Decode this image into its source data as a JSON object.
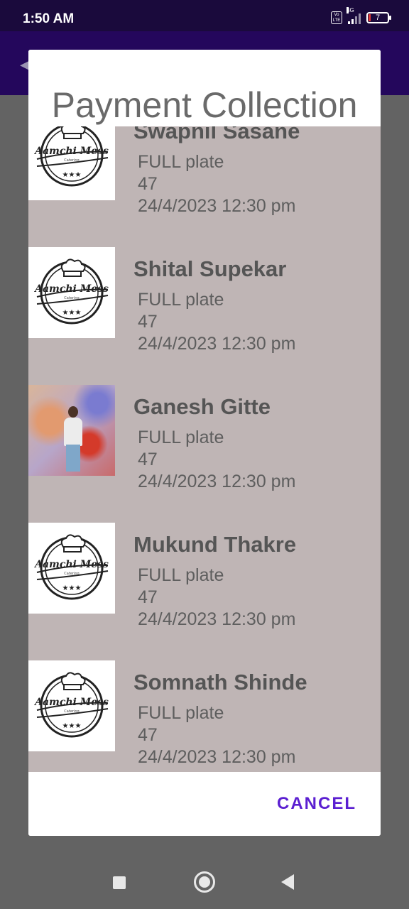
{
  "status_bar": {
    "time": "1:50 AM",
    "network": "4G",
    "volte": "Vo LTE",
    "battery": "7"
  },
  "dialog": {
    "title": "Payment Collection",
    "cancel_label": "CANCEL",
    "items": [
      {
        "name": "Swapnil Sasane",
        "plate": "FULL plate",
        "amount": "47",
        "datetime": "24/4/2023 12:30 pm",
        "image": "mess-logo"
      },
      {
        "name": "Shital Supekar",
        "plate": "FULL plate",
        "amount": "47",
        "datetime": "24/4/2023 12:30 pm",
        "image": "mess-logo"
      },
      {
        "name": "Ganesh Gitte",
        "plate": "FULL plate",
        "amount": "47",
        "datetime": "24/4/2023 12:30 pm",
        "image": "user-photo"
      },
      {
        "name": "Mukund Thakre",
        "plate": "FULL plate",
        "amount": "47",
        "datetime": "24/4/2023 12:30 pm",
        "image": "mess-logo"
      },
      {
        "name": "Somnath Shinde",
        "plate": "FULL plate",
        "amount": "47",
        "datetime": "24/4/2023 12:30 pm",
        "image": "mess-logo"
      }
    ]
  },
  "logo": {
    "text": "Aamchi Mess",
    "subtext": "Catering"
  },
  "colors": {
    "status_bar": "#1a0a3c",
    "app_bar": "#24075c",
    "list_background": "#bfb5b5",
    "accent": "#5b1fd1"
  }
}
